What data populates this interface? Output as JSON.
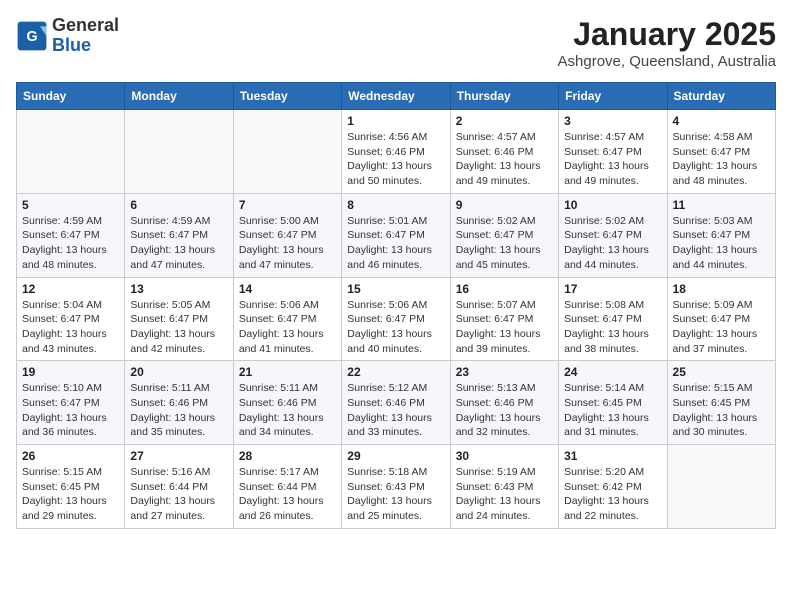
{
  "header": {
    "logo_general": "General",
    "logo_blue": "Blue",
    "month_year": "January 2025",
    "location": "Ashgrove, Queensland, Australia"
  },
  "weekdays": [
    "Sunday",
    "Monday",
    "Tuesday",
    "Wednesday",
    "Thursday",
    "Friday",
    "Saturday"
  ],
  "weeks": [
    [
      {
        "day": "",
        "info": ""
      },
      {
        "day": "",
        "info": ""
      },
      {
        "day": "",
        "info": ""
      },
      {
        "day": "1",
        "info": "Sunrise: 4:56 AM\nSunset: 6:46 PM\nDaylight: 13 hours\nand 50 minutes."
      },
      {
        "day": "2",
        "info": "Sunrise: 4:57 AM\nSunset: 6:46 PM\nDaylight: 13 hours\nand 49 minutes."
      },
      {
        "day": "3",
        "info": "Sunrise: 4:57 AM\nSunset: 6:47 PM\nDaylight: 13 hours\nand 49 minutes."
      },
      {
        "day": "4",
        "info": "Sunrise: 4:58 AM\nSunset: 6:47 PM\nDaylight: 13 hours\nand 48 minutes."
      }
    ],
    [
      {
        "day": "5",
        "info": "Sunrise: 4:59 AM\nSunset: 6:47 PM\nDaylight: 13 hours\nand 48 minutes."
      },
      {
        "day": "6",
        "info": "Sunrise: 4:59 AM\nSunset: 6:47 PM\nDaylight: 13 hours\nand 47 minutes."
      },
      {
        "day": "7",
        "info": "Sunrise: 5:00 AM\nSunset: 6:47 PM\nDaylight: 13 hours\nand 47 minutes."
      },
      {
        "day": "8",
        "info": "Sunrise: 5:01 AM\nSunset: 6:47 PM\nDaylight: 13 hours\nand 46 minutes."
      },
      {
        "day": "9",
        "info": "Sunrise: 5:02 AM\nSunset: 6:47 PM\nDaylight: 13 hours\nand 45 minutes."
      },
      {
        "day": "10",
        "info": "Sunrise: 5:02 AM\nSunset: 6:47 PM\nDaylight: 13 hours\nand 44 minutes."
      },
      {
        "day": "11",
        "info": "Sunrise: 5:03 AM\nSunset: 6:47 PM\nDaylight: 13 hours\nand 44 minutes."
      }
    ],
    [
      {
        "day": "12",
        "info": "Sunrise: 5:04 AM\nSunset: 6:47 PM\nDaylight: 13 hours\nand 43 minutes."
      },
      {
        "day": "13",
        "info": "Sunrise: 5:05 AM\nSunset: 6:47 PM\nDaylight: 13 hours\nand 42 minutes."
      },
      {
        "day": "14",
        "info": "Sunrise: 5:06 AM\nSunset: 6:47 PM\nDaylight: 13 hours\nand 41 minutes."
      },
      {
        "day": "15",
        "info": "Sunrise: 5:06 AM\nSunset: 6:47 PM\nDaylight: 13 hours\nand 40 minutes."
      },
      {
        "day": "16",
        "info": "Sunrise: 5:07 AM\nSunset: 6:47 PM\nDaylight: 13 hours\nand 39 minutes."
      },
      {
        "day": "17",
        "info": "Sunrise: 5:08 AM\nSunset: 6:47 PM\nDaylight: 13 hours\nand 38 minutes."
      },
      {
        "day": "18",
        "info": "Sunrise: 5:09 AM\nSunset: 6:47 PM\nDaylight: 13 hours\nand 37 minutes."
      }
    ],
    [
      {
        "day": "19",
        "info": "Sunrise: 5:10 AM\nSunset: 6:47 PM\nDaylight: 13 hours\nand 36 minutes."
      },
      {
        "day": "20",
        "info": "Sunrise: 5:11 AM\nSunset: 6:46 PM\nDaylight: 13 hours\nand 35 minutes."
      },
      {
        "day": "21",
        "info": "Sunrise: 5:11 AM\nSunset: 6:46 PM\nDaylight: 13 hours\nand 34 minutes."
      },
      {
        "day": "22",
        "info": "Sunrise: 5:12 AM\nSunset: 6:46 PM\nDaylight: 13 hours\nand 33 minutes."
      },
      {
        "day": "23",
        "info": "Sunrise: 5:13 AM\nSunset: 6:46 PM\nDaylight: 13 hours\nand 32 minutes."
      },
      {
        "day": "24",
        "info": "Sunrise: 5:14 AM\nSunset: 6:45 PM\nDaylight: 13 hours\nand 31 minutes."
      },
      {
        "day": "25",
        "info": "Sunrise: 5:15 AM\nSunset: 6:45 PM\nDaylight: 13 hours\nand 30 minutes."
      }
    ],
    [
      {
        "day": "26",
        "info": "Sunrise: 5:15 AM\nSunset: 6:45 PM\nDaylight: 13 hours\nand 29 minutes."
      },
      {
        "day": "27",
        "info": "Sunrise: 5:16 AM\nSunset: 6:44 PM\nDaylight: 13 hours\nand 27 minutes."
      },
      {
        "day": "28",
        "info": "Sunrise: 5:17 AM\nSunset: 6:44 PM\nDaylight: 13 hours\nand 26 minutes."
      },
      {
        "day": "29",
        "info": "Sunrise: 5:18 AM\nSunset: 6:43 PM\nDaylight: 13 hours\nand 25 minutes."
      },
      {
        "day": "30",
        "info": "Sunrise: 5:19 AM\nSunset: 6:43 PM\nDaylight: 13 hours\nand 24 minutes."
      },
      {
        "day": "31",
        "info": "Sunrise: 5:20 AM\nSunset: 6:42 PM\nDaylight: 13 hours\nand 22 minutes."
      },
      {
        "day": "",
        "info": ""
      }
    ]
  ]
}
